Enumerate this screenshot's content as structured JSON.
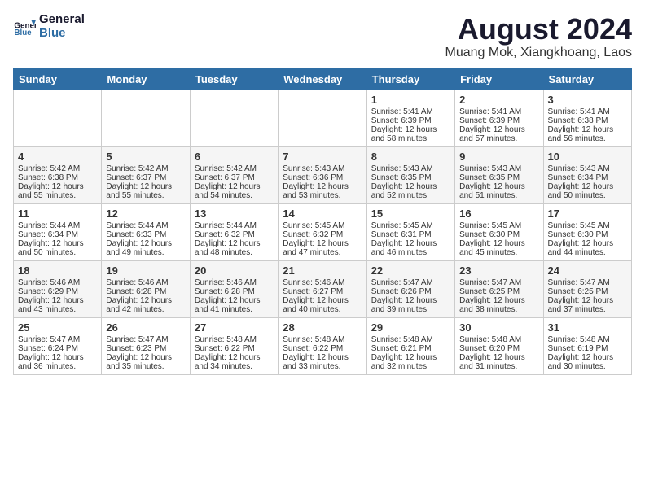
{
  "logo": {
    "line1": "General",
    "line2": "Blue"
  },
  "title": "August 2024",
  "subtitle": "Muang Mok, Xiangkhoang, Laos",
  "weekdays": [
    "Sunday",
    "Monday",
    "Tuesday",
    "Wednesday",
    "Thursday",
    "Friday",
    "Saturday"
  ],
  "weeks": [
    [
      {
        "day": "",
        "sunrise": "",
        "sunset": "",
        "daylight": ""
      },
      {
        "day": "",
        "sunrise": "",
        "sunset": "",
        "daylight": ""
      },
      {
        "day": "",
        "sunrise": "",
        "sunset": "",
        "daylight": ""
      },
      {
        "day": "",
        "sunrise": "",
        "sunset": "",
        "daylight": ""
      },
      {
        "day": "1",
        "sunrise": "Sunrise: 5:41 AM",
        "sunset": "Sunset: 6:39 PM",
        "daylight": "Daylight: 12 hours and 58 minutes."
      },
      {
        "day": "2",
        "sunrise": "Sunrise: 5:41 AM",
        "sunset": "Sunset: 6:39 PM",
        "daylight": "Daylight: 12 hours and 57 minutes."
      },
      {
        "day": "3",
        "sunrise": "Sunrise: 5:41 AM",
        "sunset": "Sunset: 6:38 PM",
        "daylight": "Daylight: 12 hours and 56 minutes."
      }
    ],
    [
      {
        "day": "4",
        "sunrise": "Sunrise: 5:42 AM",
        "sunset": "Sunset: 6:38 PM",
        "daylight": "Daylight: 12 hours and 55 minutes."
      },
      {
        "day": "5",
        "sunrise": "Sunrise: 5:42 AM",
        "sunset": "Sunset: 6:37 PM",
        "daylight": "Daylight: 12 hours and 55 minutes."
      },
      {
        "day": "6",
        "sunrise": "Sunrise: 5:42 AM",
        "sunset": "Sunset: 6:37 PM",
        "daylight": "Daylight: 12 hours and 54 minutes."
      },
      {
        "day": "7",
        "sunrise": "Sunrise: 5:43 AM",
        "sunset": "Sunset: 6:36 PM",
        "daylight": "Daylight: 12 hours and 53 minutes."
      },
      {
        "day": "8",
        "sunrise": "Sunrise: 5:43 AM",
        "sunset": "Sunset: 6:35 PM",
        "daylight": "Daylight: 12 hours and 52 minutes."
      },
      {
        "day": "9",
        "sunrise": "Sunrise: 5:43 AM",
        "sunset": "Sunset: 6:35 PM",
        "daylight": "Daylight: 12 hours and 51 minutes."
      },
      {
        "day": "10",
        "sunrise": "Sunrise: 5:43 AM",
        "sunset": "Sunset: 6:34 PM",
        "daylight": "Daylight: 12 hours and 50 minutes."
      }
    ],
    [
      {
        "day": "11",
        "sunrise": "Sunrise: 5:44 AM",
        "sunset": "Sunset: 6:34 PM",
        "daylight": "Daylight: 12 hours and 50 minutes."
      },
      {
        "day": "12",
        "sunrise": "Sunrise: 5:44 AM",
        "sunset": "Sunset: 6:33 PM",
        "daylight": "Daylight: 12 hours and 49 minutes."
      },
      {
        "day": "13",
        "sunrise": "Sunrise: 5:44 AM",
        "sunset": "Sunset: 6:32 PM",
        "daylight": "Daylight: 12 hours and 48 minutes."
      },
      {
        "day": "14",
        "sunrise": "Sunrise: 5:45 AM",
        "sunset": "Sunset: 6:32 PM",
        "daylight": "Daylight: 12 hours and 47 minutes."
      },
      {
        "day": "15",
        "sunrise": "Sunrise: 5:45 AM",
        "sunset": "Sunset: 6:31 PM",
        "daylight": "Daylight: 12 hours and 46 minutes."
      },
      {
        "day": "16",
        "sunrise": "Sunrise: 5:45 AM",
        "sunset": "Sunset: 6:30 PM",
        "daylight": "Daylight: 12 hours and 45 minutes."
      },
      {
        "day": "17",
        "sunrise": "Sunrise: 5:45 AM",
        "sunset": "Sunset: 6:30 PM",
        "daylight": "Daylight: 12 hours and 44 minutes."
      }
    ],
    [
      {
        "day": "18",
        "sunrise": "Sunrise: 5:46 AM",
        "sunset": "Sunset: 6:29 PM",
        "daylight": "Daylight: 12 hours and 43 minutes."
      },
      {
        "day": "19",
        "sunrise": "Sunrise: 5:46 AM",
        "sunset": "Sunset: 6:28 PM",
        "daylight": "Daylight: 12 hours and 42 minutes."
      },
      {
        "day": "20",
        "sunrise": "Sunrise: 5:46 AM",
        "sunset": "Sunset: 6:28 PM",
        "daylight": "Daylight: 12 hours and 41 minutes."
      },
      {
        "day": "21",
        "sunrise": "Sunrise: 5:46 AM",
        "sunset": "Sunset: 6:27 PM",
        "daylight": "Daylight: 12 hours and 40 minutes."
      },
      {
        "day": "22",
        "sunrise": "Sunrise: 5:47 AM",
        "sunset": "Sunset: 6:26 PM",
        "daylight": "Daylight: 12 hours and 39 minutes."
      },
      {
        "day": "23",
        "sunrise": "Sunrise: 5:47 AM",
        "sunset": "Sunset: 6:25 PM",
        "daylight": "Daylight: 12 hours and 38 minutes."
      },
      {
        "day": "24",
        "sunrise": "Sunrise: 5:47 AM",
        "sunset": "Sunset: 6:25 PM",
        "daylight": "Daylight: 12 hours and 37 minutes."
      }
    ],
    [
      {
        "day": "25",
        "sunrise": "Sunrise: 5:47 AM",
        "sunset": "Sunset: 6:24 PM",
        "daylight": "Daylight: 12 hours and 36 minutes."
      },
      {
        "day": "26",
        "sunrise": "Sunrise: 5:47 AM",
        "sunset": "Sunset: 6:23 PM",
        "daylight": "Daylight: 12 hours and 35 minutes."
      },
      {
        "day": "27",
        "sunrise": "Sunrise: 5:48 AM",
        "sunset": "Sunset: 6:22 PM",
        "daylight": "Daylight: 12 hours and 34 minutes."
      },
      {
        "day": "28",
        "sunrise": "Sunrise: 5:48 AM",
        "sunset": "Sunset: 6:22 PM",
        "daylight": "Daylight: 12 hours and 33 minutes."
      },
      {
        "day": "29",
        "sunrise": "Sunrise: 5:48 AM",
        "sunset": "Sunset: 6:21 PM",
        "daylight": "Daylight: 12 hours and 32 minutes."
      },
      {
        "day": "30",
        "sunrise": "Sunrise: 5:48 AM",
        "sunset": "Sunset: 6:20 PM",
        "daylight": "Daylight: 12 hours and 31 minutes."
      },
      {
        "day": "31",
        "sunrise": "Sunrise: 5:48 AM",
        "sunset": "Sunset: 6:19 PM",
        "daylight": "Daylight: 12 hours and 30 minutes."
      }
    ]
  ]
}
